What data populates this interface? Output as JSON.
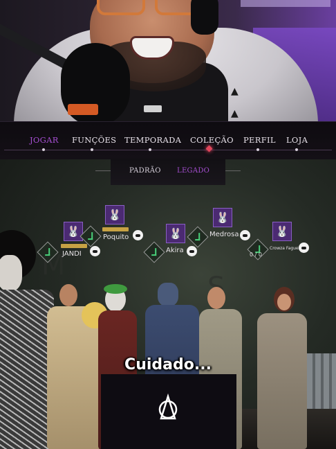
{
  "nav": {
    "items": [
      {
        "label": "JOGAR",
        "active": true
      },
      {
        "label": "FUNÇÕES",
        "active": false
      },
      {
        "label": "TEMPORADA",
        "active": false
      },
      {
        "label": "COLEÇÃO",
        "active": false
      },
      {
        "label": "PERFIL",
        "active": false
      },
      {
        "label": "LOJA",
        "active": false
      }
    ]
  },
  "subnav": {
    "items": [
      {
        "label": "PADRÃO",
        "active": false
      },
      {
        "label": "LEGADO",
        "active": true
      }
    ]
  },
  "players": [
    {
      "name": "JANDI"
    },
    {
      "name": "Poquito"
    },
    {
      "name": "Akira"
    },
    {
      "name": "Medrosa"
    },
    {
      "name": "Crowza Fagueiras",
      "score": "0 / 0"
    }
  ],
  "caption": "Cuidado...",
  "colors": {
    "accent": "#a64fd2",
    "check": "#49d07a",
    "badge": "#4b2a72"
  },
  "icons": {
    "player_badge": "bunny-icon",
    "ready": "check-icon",
    "chat": "chat-bubble-icon"
  }
}
